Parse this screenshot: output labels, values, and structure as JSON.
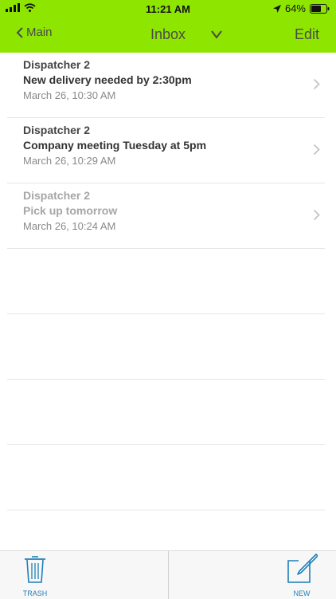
{
  "status_bar": {
    "time": "11:21 AM",
    "battery_percent": "64%"
  },
  "nav": {
    "back_label": "Main",
    "title": "Inbox",
    "edit_label": "Edit"
  },
  "messages": [
    {
      "sender": "Dispatcher 2",
      "subject": "New delivery needed by 2:30pm",
      "date": "March 26, 10:30 AM",
      "read": false
    },
    {
      "sender": "Dispatcher 2",
      "subject": "Company meeting Tuesday at 5pm",
      "date": "March 26, 10:29 AM",
      "read": false
    },
    {
      "sender": "Dispatcher 2",
      "subject": "Pick up tomorrow",
      "date": "March 26, 10:24 AM",
      "read": true
    }
  ],
  "toolbar": {
    "trash_label": "TRASH",
    "new_label": "NEW"
  },
  "colors": {
    "nav_bg": "#8ee600",
    "accent": "#1f7fb8"
  }
}
